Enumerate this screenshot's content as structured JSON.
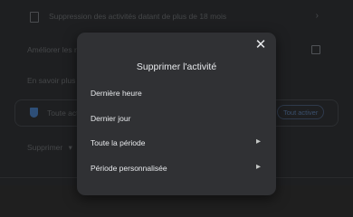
{
  "background": {
    "row1_text": "Suppression des activités datant de plus de 18 mois",
    "row2_text": "Améliorer les résultats",
    "row3_text": "En savoir plus",
    "card_text": "Toute activité",
    "card_button": "Tout activer",
    "dropdown_label": "Supprimer",
    "dropdown_icon": "chevron-down-icon"
  },
  "dialog": {
    "title": "Supprimer l'activité",
    "close_icon": "close-icon",
    "options": [
      {
        "label": "Dernière heure",
        "has_chevron": false
      },
      {
        "label": "Dernier jour",
        "has_chevron": false
      },
      {
        "label": "Toute la période",
        "has_chevron": true
      },
      {
        "label": "Période personnalisée",
        "has_chevron": true
      }
    ]
  },
  "colors": {
    "dialog_bg": "#303134",
    "page_bg": "#1e1f21",
    "text": "#e8eaed"
  }
}
